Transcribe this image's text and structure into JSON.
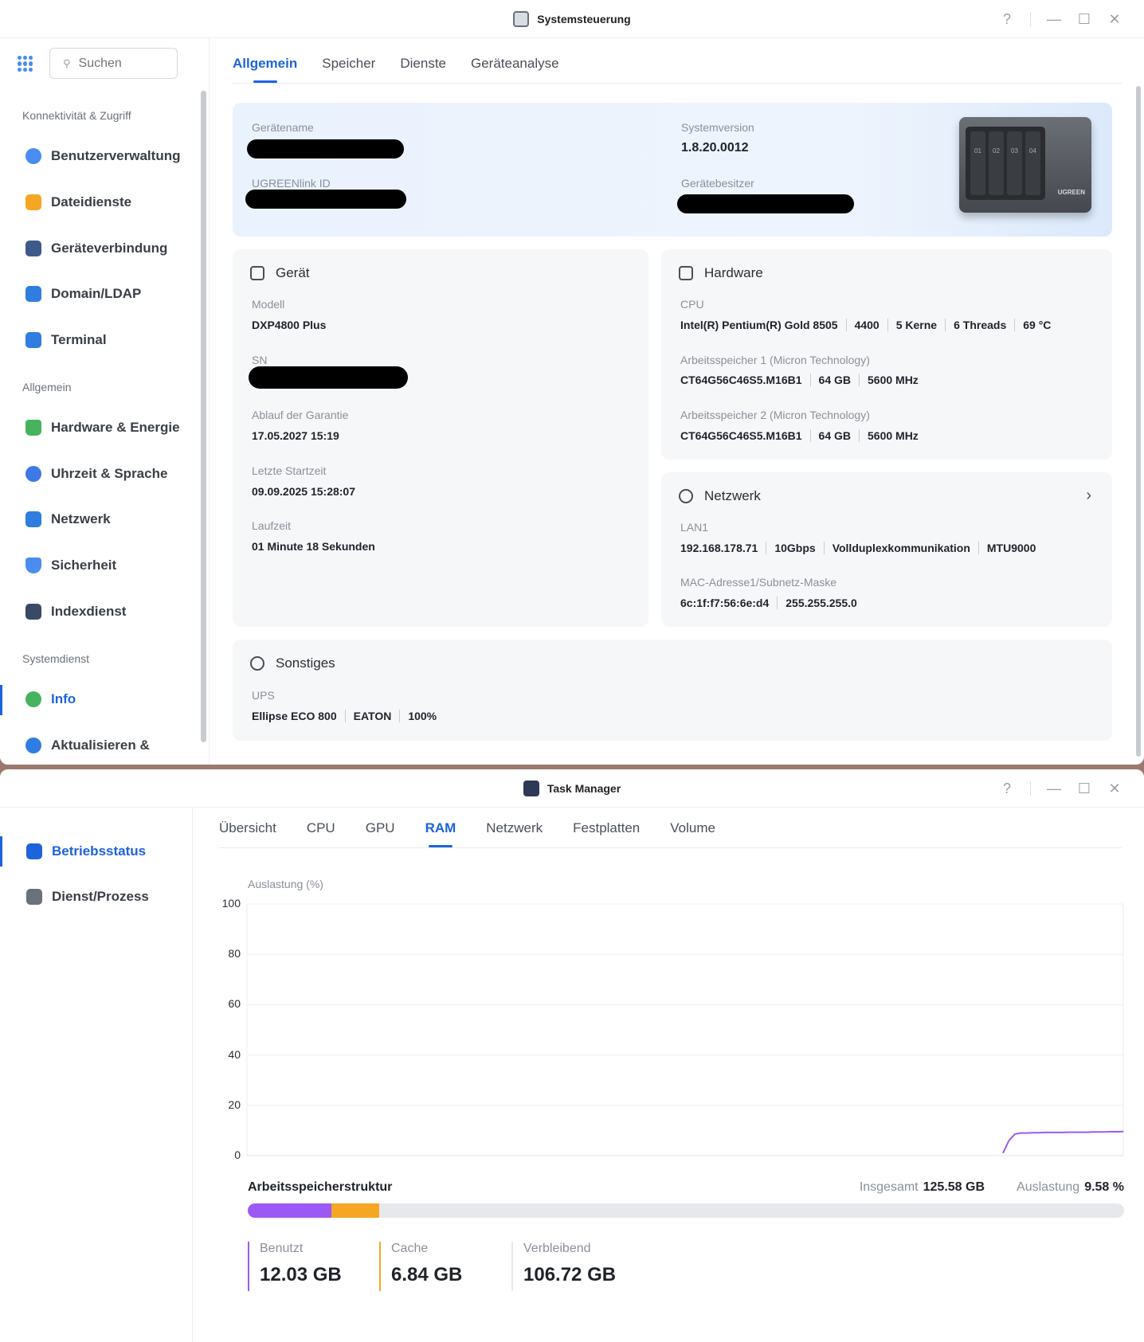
{
  "control_panel": {
    "title": "Systemsteuerung",
    "search_placeholder": "Suchen",
    "sections": [
      {
        "label": "Konnektivität & Zugriff"
      },
      {
        "label": "Allgemein"
      },
      {
        "label": "Systemdienst"
      }
    ],
    "nav": [
      {
        "label": "Benutzerverwaltung",
        "color": "#4a8cf0"
      },
      {
        "label": "Dateidienste",
        "color": "#f5a623"
      },
      {
        "label": "Geräteverbindung",
        "color": "#3d5a8a"
      },
      {
        "label": "Domain/LDAP",
        "color": "#2f7de1"
      },
      {
        "label": "Terminal",
        "color": "#2f7de1"
      },
      {
        "label": "Hardware & Energie",
        "color": "#47b35e"
      },
      {
        "label": "Uhrzeit & Sprache",
        "color": "#3d7ae8"
      },
      {
        "label": "Netzwerk",
        "color": "#2f7de1"
      },
      {
        "label": "Sicherheit",
        "color": "#4a8cf0"
      },
      {
        "label": "Indexdienst",
        "color": "#3a4a66"
      },
      {
        "label": "Info",
        "color": "#47b35e"
      },
      {
        "label": "Aktualisieren &",
        "color": "#2f7de1"
      }
    ],
    "tabs": [
      "Allgemein",
      "Speicher",
      "Dienste",
      "Geräteanalyse"
    ],
    "summary": {
      "device_name_label": "Gerätename",
      "ugreen_id_label": "UGREENlink ID",
      "system_version_label": "Systemversion",
      "system_version": "1.8.20.0012",
      "owner_label": "Gerätebesitzer",
      "nas_bays": [
        "01",
        "02",
        "03",
        "04"
      ],
      "nas_brand": "UGREEN"
    },
    "device": {
      "title": "Gerät",
      "model_label": "Modell",
      "model": "DXP4800 Plus",
      "sn_label": "SN",
      "warranty_label": "Ablauf der Garantie",
      "warranty": "17.05.2027 15:19",
      "last_start_label": "Letzte Startzeit",
      "last_start": "09.09.2025 15:28:07",
      "uptime_label": "Laufzeit",
      "uptime": "01 Minute 18 Sekunden"
    },
    "hardware": {
      "title": "Hardware",
      "cpu_label": "CPU",
      "cpu": [
        "Intel(R) Pentium(R) Gold 8505",
        "4400",
        "5 Kerne",
        "6 Threads",
        "69 °C"
      ],
      "ram1_label": "Arbeitsspeicher 1 (Micron Technology)",
      "ram1": [
        "CT64G56C46S5.M16B1",
        "64 GB",
        "5600 MHz"
      ],
      "ram2_label": "Arbeitsspeicher 2 (Micron Technology)",
      "ram2": [
        "CT64G56C46S5.M16B1",
        "64 GB",
        "5600 MHz"
      ]
    },
    "network": {
      "title": "Netzwerk",
      "lan_label": "LAN1",
      "lan": [
        "192.168.178.71",
        "10Gbps",
        "Vollduplexkommunikation",
        "MTU9000"
      ],
      "mac_label": "MAC-Adresse1/Subnetz-Maske",
      "mac": [
        "6c:1f:f7:56:6e:d4",
        "255.255.255.0"
      ]
    },
    "misc": {
      "title": "Sonstiges",
      "ups_label": "UPS",
      "ups": [
        "Ellipse ECO 800",
        "EATON",
        "100%"
      ]
    }
  },
  "task_manager": {
    "title": "Task Manager",
    "nav": [
      "Betriebsstatus",
      "Dienst/Prozess"
    ],
    "tabs": [
      "Übersicht",
      "CPU",
      "GPU",
      "RAM",
      "Netzwerk",
      "Festplatten",
      "Volume"
    ],
    "chart_label": "Auslastung (%)",
    "structure_title": "Arbeitsspeicherstruktur",
    "total_label": "Insgesamt",
    "total_value": "125.58 GB",
    "usage_label": "Auslastung",
    "usage_value": "9.58 %",
    "legend": [
      {
        "label": "Benutzt",
        "value": "12.03 GB",
        "color": "#9b59f5",
        "gb": 12.03
      },
      {
        "label": "Cache",
        "value": "6.84 GB",
        "color": "#f5a623",
        "gb": 6.84
      },
      {
        "label": "Verbleibend",
        "value": "106.72 GB",
        "color": "#e6e8ec",
        "gb": 106.72
      }
    ]
  },
  "chart_data": {
    "type": "line",
    "title": "",
    "ylabel": "Auslastung (%)",
    "ylim": [
      0,
      100
    ],
    "yticks": [
      0,
      20,
      40,
      60,
      80,
      100
    ],
    "grid": true,
    "series": [
      {
        "color": "#9b59f5",
        "x": [
          0,
          1,
          2,
          3,
          4,
          5,
          6,
          7,
          8,
          9,
          10,
          11,
          12,
          13,
          14,
          15,
          16,
          17,
          18,
          19,
          20
        ],
        "values": [
          1.0,
          6.0,
          8.6,
          9.0,
          9.0,
          9.1,
          9.1,
          9.2,
          9.2,
          9.2,
          9.2,
          9.3,
          9.3,
          9.3,
          9.3,
          9.4,
          9.4,
          9.4,
          9.5,
          9.5,
          9.6
        ]
      }
    ]
  }
}
